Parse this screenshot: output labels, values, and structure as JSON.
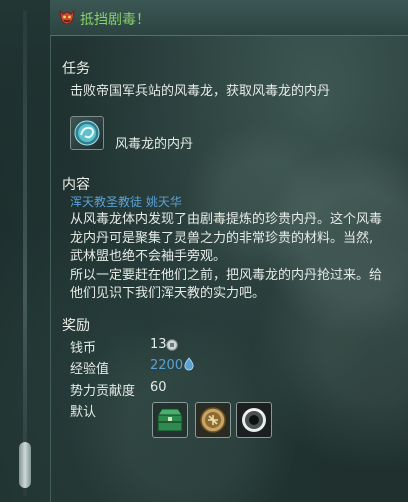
{
  "title": "抵挡剧毒！",
  "task": {
    "heading": "任务",
    "objective": "击败帝国军兵站的风毒龙，获取风毒龙的内丹",
    "item_name": "风毒龙的内丹"
  },
  "content": {
    "heading": "内容",
    "npc": "浑天教圣教徒 姚天华",
    "lines": [
      "从风毒龙体内发现了由剧毒提炼的珍贵内丹。这个风毒",
      "龙内丹可是聚集了灵兽之力的非常珍贵的材料。当然,",
      "武林盟也绝不会袖手旁观。",
      "所以一定要赶在他们之前，把风毒龙的内丹抢过来。给",
      "他们见识下我们浑天教的实力吧。"
    ]
  },
  "rewards": {
    "heading": "奖励",
    "coins_label": "钱币",
    "coins_value": "13",
    "exp_label": "经验值",
    "exp_value": "2200",
    "faction_label": "势力贡献度",
    "faction_value": "60",
    "default_label": "默认"
  },
  "colors": {
    "title": "#88d06a",
    "npc": "#5aa0d2",
    "exp": "#5aa0d2"
  },
  "icons": {
    "title": "demon-mask-icon",
    "task_item": "swirl-orb-icon",
    "coin": "coin-icon",
    "exp": "exp-drop-icon",
    "reward_1": "green-chest-icon",
    "reward_2": "talisman-icon",
    "reward_3": "dark-orb-icon"
  }
}
